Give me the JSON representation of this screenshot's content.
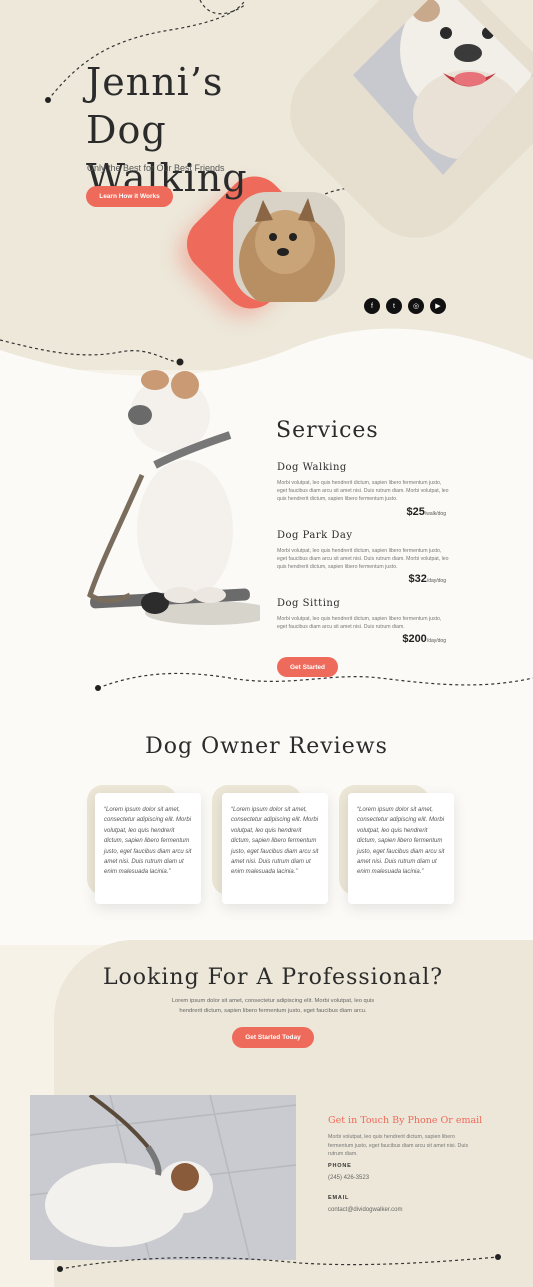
{
  "hero": {
    "title_line1": "Jenni’s Dog",
    "title_line2": "Walking",
    "subtitle": "Only the Best for Our Best Friends",
    "button_label": "Learn How it Works",
    "social": [
      {
        "icon": "facebook-icon",
        "glyph": "f"
      },
      {
        "icon": "twitter-icon",
        "glyph": "t"
      },
      {
        "icon": "instagram-icon",
        "glyph": "◎"
      },
      {
        "icon": "youtube-icon",
        "glyph": "▶"
      }
    ]
  },
  "services": {
    "title": "Services",
    "items": [
      {
        "name": "Dog Walking",
        "desc": "Morbi volutpat, leo quis hendrerit dictum, sapien libero fermentum justo, eget faucibus diam arcu sit amet nisi. Duis rutrum diam. Morbi volutpat, leo quis hendrerit dictum, sapien libero fermentum justo.",
        "price": "$25",
        "unit": "/walk/dog"
      },
      {
        "name": "Dog Park Day",
        "desc": "Morbi volutpat, leo quis hendrerit dictum, sapien libero fermentum justo, eget faucibus diam arcu sit amet nisi. Duis rutrum diam. Morbi volutpat, leo quis hendrerit dictum, sapien libero fermentum justo.",
        "price": "$32",
        "unit": "/day/dog"
      },
      {
        "name": "Dog Sitting",
        "desc": "Morbi volutpat, leo quis hendrerit dictum, sapien libero fermentum justo, eget faucibus diam arcu sit amet nisi. Duis rutrum diam.",
        "price": "$200",
        "unit": "/day/dog"
      }
    ],
    "button_label": "Get Started"
  },
  "reviews": {
    "title": "Dog Owner Reviews",
    "items": [
      {
        "text": "“Lorem ipsum dolor sit amet, consectetur adipiscing elit. Morbi volutpat, leo quis hendrerit dictum, sapien libero fermentum justo, eget faucibus diam arcu sit amet nisi. Duis rutrum diam ut enim malesuada lacinia.”"
      },
      {
        "text": "“Lorem ipsum dolor sit amet, consectetur adipiscing elit. Morbi volutpat, leo quis hendrerit dictum, sapien libero fermentum justo, eget faucibus diam arcu sit amet nisi. Duis rutrum diam ut enim malesuada lacinia.”"
      },
      {
        "text": "“Lorem ipsum dolor sit amet, consectetur adipiscing elit. Morbi volutpat, leo quis hendrerit dictum, sapien libero fermentum justo, eget faucibus diam arcu sit amet nisi. Duis rutrum diam ut enim malesuada lacinia.”"
      }
    ]
  },
  "cta": {
    "title": "Looking For A Professional?",
    "text": "Lorem ipsum dolor sit amet, consectetur adipiscing elit. Morbi volutpat, leo quis hendrerit dictum, sapien libero fermentum justo, eget faucibus diam arcu.",
    "button_label": "Get Started Today"
  },
  "contact": {
    "title": "Get in Touch By Phone Or email",
    "text": "Morbi volutpat, leo quis hendrerit dictum, sapien libero fermentum justo, eget faucibus diam arcu sit amet nisi. Duis rutrum diam.",
    "phone_label": "PHONE",
    "phone": "(245) 426-3523",
    "email_label": "EMAIL",
    "email": "contact@dividogwalker.com"
  },
  "colors": {
    "accent": "#ee6a5b",
    "beige": "#ede8da",
    "dark": "#2b2b2b"
  }
}
